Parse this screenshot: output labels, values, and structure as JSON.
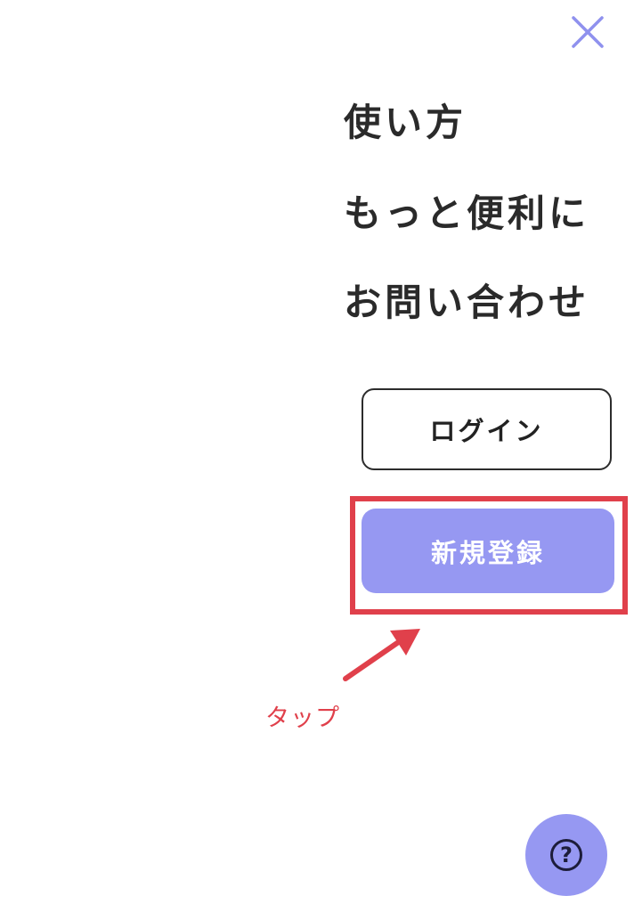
{
  "menu": {
    "items": [
      {
        "label": "使い方"
      },
      {
        "label": "もっと便利に"
      },
      {
        "label": "お問い合わせ"
      }
    ]
  },
  "buttons": {
    "login_label": "ログイン",
    "signup_label": "新規登録"
  },
  "annotation": {
    "tap_label": "タップ"
  },
  "help": {
    "glyph": "?"
  },
  "icons": {
    "close": "close-icon",
    "arrow": "arrow-up-right-icon",
    "help": "question-circle-icon"
  },
  "colors": {
    "accent": "#9698f2",
    "annotation": "#e0404b",
    "text": "#2a2a2a"
  }
}
